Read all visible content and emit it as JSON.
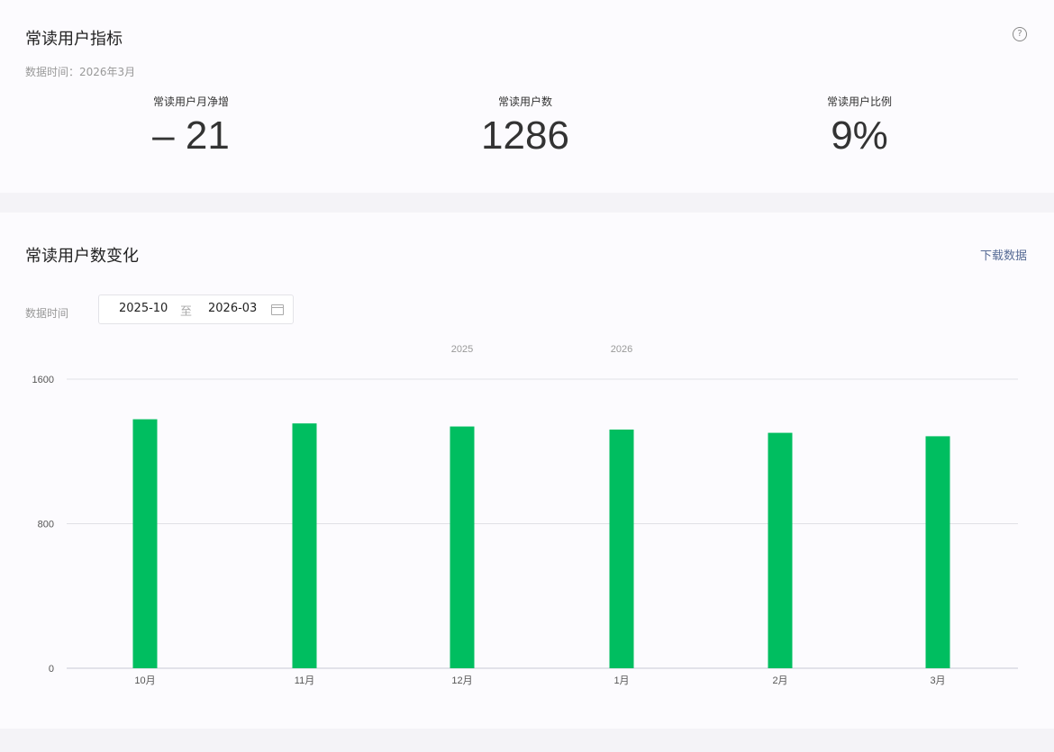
{
  "metrics_card": {
    "title": "常读用户指标",
    "help_icon": "question-circle-icon",
    "data_time": "数据时间：2026年3月",
    "metrics": [
      {
        "label": "常读用户月净增",
        "value": "– 21"
      },
      {
        "label": "常读用户数",
        "value": "1286"
      },
      {
        "label": "常读用户比例",
        "value": "9%"
      }
    ]
  },
  "trend_card": {
    "title": "常读用户数变化",
    "download_label": "下载数据",
    "filter_label": "数据时间",
    "date_start": "2025-10",
    "date_separator": "至",
    "date_end": "2026-03",
    "calendar_icon": "calendar-icon"
  },
  "colors": {
    "bar": "#00be60",
    "link": "#576b95",
    "grid": "#e0e0e6"
  },
  "chart_data": {
    "type": "bar",
    "categories": [
      "10月",
      "11月",
      "12月",
      "1月",
      "2月",
      "3月"
    ],
    "year_labels": [
      {
        "label": "2025",
        "between": [
          "11月",
          "12月"
        ]
      },
      {
        "label": "2026",
        "between": [
          "12月",
          "1月"
        ]
      }
    ],
    "values": [
      1378,
      1355,
      1338,
      1321,
      1303,
      1284
    ],
    "y_ticks": [
      0,
      800,
      1600
    ],
    "ylim": [
      0,
      1600
    ],
    "grid": true,
    "legend": "none"
  }
}
